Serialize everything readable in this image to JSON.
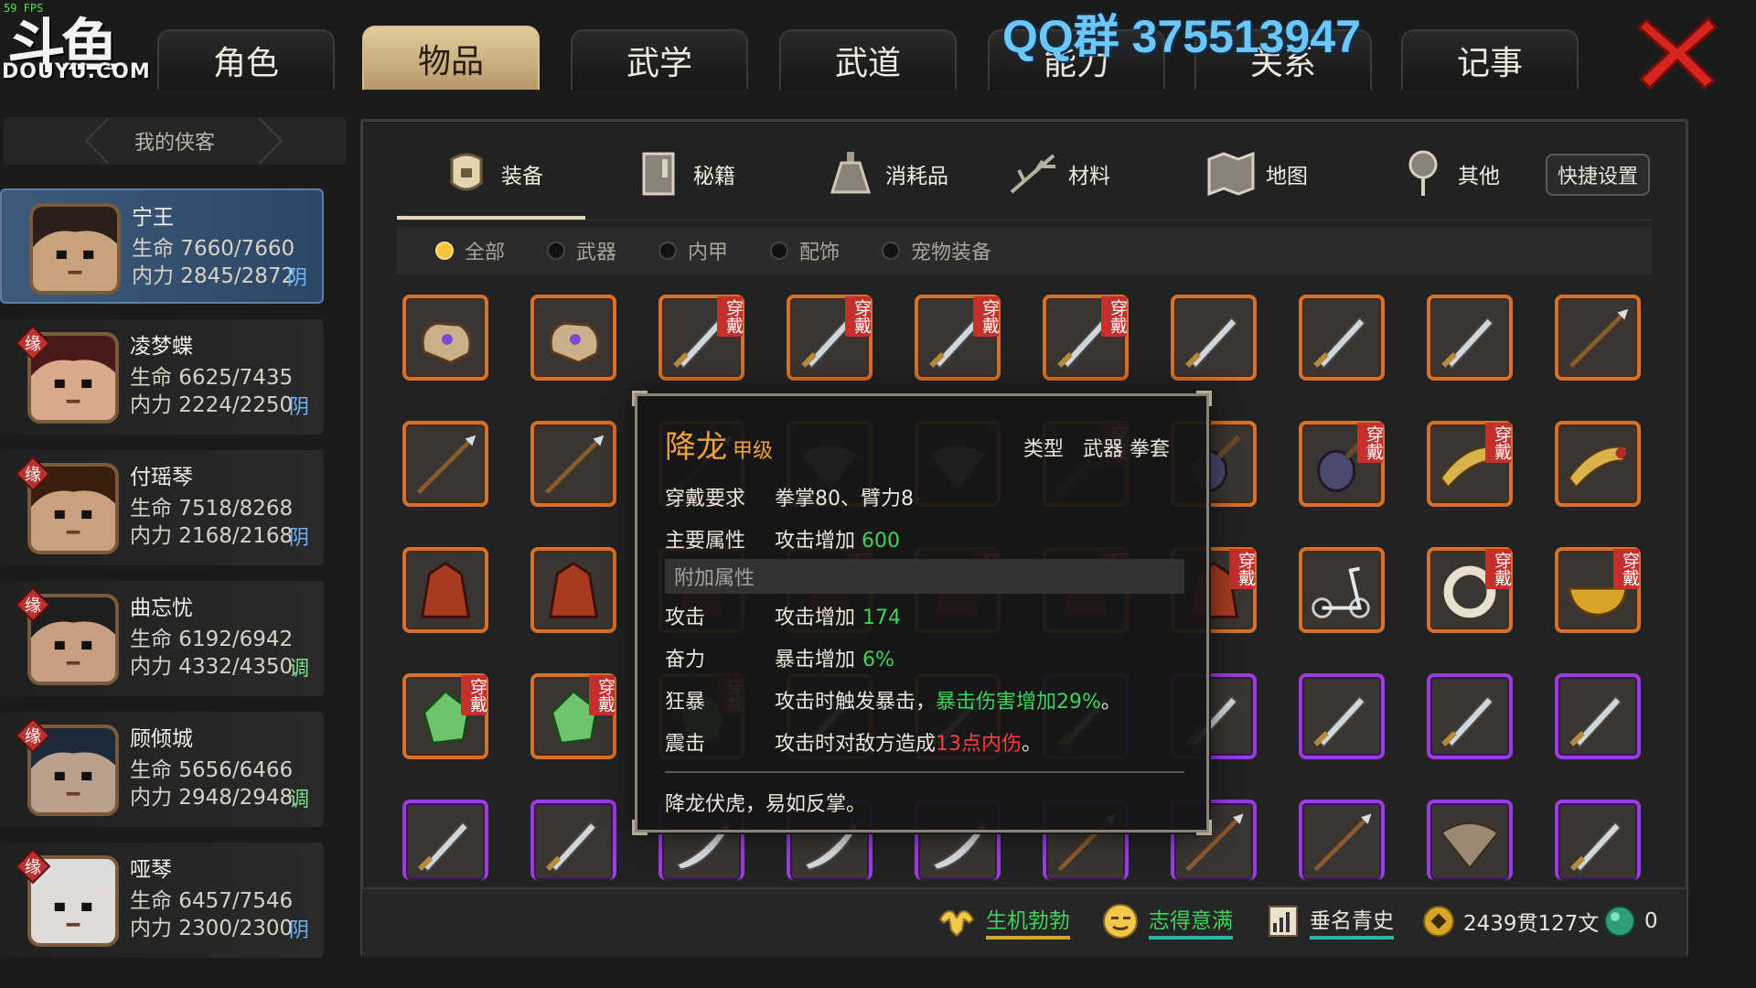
{
  "overlay": {
    "fps": "59 FPS",
    "logo_cn": "斗鱼",
    "logo_en": "DOUYU.COM",
    "qq_text": "QQ群 375513947"
  },
  "top_tabs": [
    "角色",
    "物品",
    "武学",
    "武道",
    "能力",
    "关系",
    "记事"
  ],
  "active_top_tab": "物品",
  "left_panel": {
    "header": "我的侠客",
    "characters": [
      {
        "name": "宁王",
        "hp": "生命 7660/7660",
        "mp": "内力 2845/2872",
        "align": "阴",
        "fate": false
      },
      {
        "name": "凌梦蝶",
        "hp": "生命 6625/7435",
        "mp": "内力 2224/2250",
        "align": "阴",
        "fate": true
      },
      {
        "name": "付瑶琴",
        "hp": "生命 7518/8268",
        "mp": "内力 2168/2168",
        "align": "阴",
        "fate": true
      },
      {
        "name": "曲忘忧",
        "hp": "生命 6192/6942",
        "mp": "内力 4332/4350",
        "align": "调",
        "fate": true
      },
      {
        "name": "顾倾城",
        "hp": "生命 5656/6466",
        "mp": "内力 2948/2948",
        "align": "调",
        "fate": true
      },
      {
        "name": "哑琴",
        "hp": "生命 6457/7546",
        "mp": "内力 2300/2300",
        "align": "阴",
        "fate": true
      }
    ],
    "fate_badge": "缘"
  },
  "categories": [
    {
      "label": "装备",
      "icon": "armor-icon"
    },
    {
      "label": "秘籍",
      "icon": "book-icon"
    },
    {
      "label": "消耗品",
      "icon": "potion-icon"
    },
    {
      "label": "材料",
      "icon": "branch-icon"
    },
    {
      "label": "地图",
      "icon": "map-icon"
    },
    {
      "label": "其他",
      "icon": "pin-icon"
    }
  ],
  "active_category": "装备",
  "quick_settings": "快捷设置",
  "filters": [
    {
      "label": "全部",
      "on": true
    },
    {
      "label": "武器",
      "on": false
    },
    {
      "label": "内甲",
      "on": false
    },
    {
      "label": "配饰",
      "on": false
    },
    {
      "label": "宠物装备",
      "on": false
    }
  ],
  "worn_badge": "穿戴",
  "items": [
    {
      "kind": "glove",
      "rarity": "orange",
      "worn": false
    },
    {
      "kind": "glove",
      "rarity": "orange",
      "worn": false
    },
    {
      "kind": "sword",
      "rarity": "orange",
      "worn": true
    },
    {
      "kind": "sword",
      "rarity": "orange",
      "worn": true
    },
    {
      "kind": "sword",
      "rarity": "orange",
      "worn": true
    },
    {
      "kind": "sword",
      "rarity": "orange",
      "worn": true
    },
    {
      "kind": "sword",
      "rarity": "orange",
      "worn": false
    },
    {
      "kind": "sword",
      "rarity": "orange",
      "worn": false
    },
    {
      "kind": "sword",
      "rarity": "orange",
      "worn": false
    },
    {
      "kind": "spear",
      "rarity": "orange",
      "worn": false
    },
    {
      "kind": "spear",
      "rarity": "orange",
      "worn": false
    },
    {
      "kind": "spear",
      "rarity": "orange",
      "worn": false
    },
    {
      "kind": "spear",
      "rarity": "orange",
      "worn": false
    },
    {
      "kind": "fan",
      "rarity": "orange",
      "worn": false
    },
    {
      "kind": "fan",
      "rarity": "orange",
      "worn": false
    },
    {
      "kind": "spear",
      "rarity": "orange",
      "worn": true
    },
    {
      "kind": "lute",
      "rarity": "orange",
      "worn": false
    },
    {
      "kind": "lute",
      "rarity": "orange",
      "worn": true
    },
    {
      "kind": "horn",
      "rarity": "orange",
      "worn": true
    },
    {
      "kind": "horn",
      "rarity": "orange",
      "worn": false
    },
    {
      "kind": "robe",
      "rarity": "orange",
      "worn": false
    },
    {
      "kind": "robe",
      "rarity": "orange",
      "worn": false
    },
    {
      "kind": "robe",
      "rarity": "orange",
      "worn": false
    },
    {
      "kind": "robe",
      "rarity": "orange",
      "worn": true
    },
    {
      "kind": "robe",
      "rarity": "orange",
      "worn": true
    },
    {
      "kind": "robe",
      "rarity": "orange",
      "worn": true
    },
    {
      "kind": "robe",
      "rarity": "orange",
      "worn": true
    },
    {
      "kind": "scooter",
      "rarity": "orange",
      "worn": false
    },
    {
      "kind": "ring",
      "rarity": "orange",
      "worn": true
    },
    {
      "kind": "bowl",
      "rarity": "orange",
      "worn": true
    },
    {
      "kind": "gem",
      "rarity": "orange",
      "worn": true
    },
    {
      "kind": "gem",
      "rarity": "orange",
      "worn": true
    },
    {
      "kind": "gem",
      "rarity": "orange",
      "worn": true
    },
    {
      "kind": "sword",
      "rarity": "orange",
      "worn": false
    },
    {
      "kind": "sword",
      "rarity": "orange",
      "worn": false
    },
    {
      "kind": "sword",
      "rarity": "purple",
      "worn": false
    },
    {
      "kind": "sword",
      "rarity": "purple",
      "worn": false
    },
    {
      "kind": "sword",
      "rarity": "purple",
      "worn": false
    },
    {
      "kind": "sword",
      "rarity": "purple",
      "worn": false
    },
    {
      "kind": "sword",
      "rarity": "purple",
      "worn": false
    },
    {
      "kind": "sword",
      "rarity": "purple",
      "worn": false
    },
    {
      "kind": "sword",
      "rarity": "purple",
      "worn": false
    },
    {
      "kind": "blade",
      "rarity": "purple",
      "worn": false
    },
    {
      "kind": "blade",
      "rarity": "purple",
      "worn": false
    },
    {
      "kind": "blade",
      "rarity": "purple",
      "worn": false
    },
    {
      "kind": "spear",
      "rarity": "purple",
      "worn": false
    },
    {
      "kind": "spear",
      "rarity": "purple",
      "worn": false
    },
    {
      "kind": "spear",
      "rarity": "purple",
      "worn": false
    },
    {
      "kind": "fan",
      "rarity": "purple",
      "worn": false
    },
    {
      "kind": "sword",
      "rarity": "purple",
      "worn": false
    }
  ],
  "tooltip": {
    "name": "降龙",
    "grade": "甲级",
    "type_label": "类型",
    "type_value": "武器 拳套",
    "req_label": "穿戴要求",
    "req_value": "拳掌80、臂力8",
    "main_label": "主要属性",
    "main_value": "攻击增加",
    "main_num": "600",
    "extra_section": "附加属性",
    "attrs": [
      {
        "key": "攻击",
        "text": "攻击增加",
        "hl": "174",
        "hl_color": "green",
        "tail": ""
      },
      {
        "key": "奋力",
        "text": "暴击增加",
        "hl": "6%",
        "hl_color": "green",
        "tail": ""
      },
      {
        "key": "狂暴",
        "text": "攻击时触发暴击，",
        "hl": "暴击伤害增加29%",
        "hl_color": "green",
        "tail": "。"
      },
      {
        "key": "震击",
        "text": "攻击时对敌方造成",
        "hl": "13点内伤",
        "hl_color": "red",
        "tail": "。"
      }
    ],
    "flavor": "降龙伏虎，易如反掌。"
  },
  "bottom_bar": {
    "status1": "生机勃勃",
    "status2": "志得意满",
    "status3": "垂名青史",
    "money": "2439贯127文",
    "gems": "0"
  },
  "colors": {
    "accent_gold": "#e0cc9e",
    "worn_red": "#c5302d",
    "rarity_orange": "#d7702a",
    "rarity_purple": "#9a3ce0",
    "green": "#3ed35a"
  }
}
